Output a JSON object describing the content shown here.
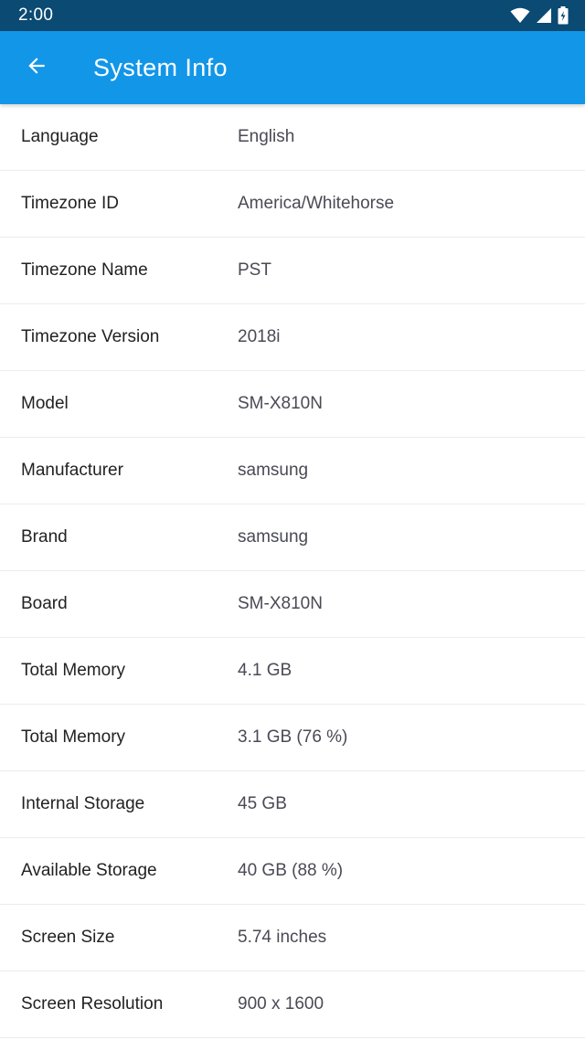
{
  "status_bar": {
    "time": "2:00",
    "icons": [
      "wifi-icon",
      "signal-icon",
      "battery-icon"
    ]
  },
  "app_bar": {
    "title": "System Info",
    "back_icon": "arrow-back-icon",
    "color": "#1296e8"
  },
  "colors": {
    "status_bar": "#0a4a73",
    "app_bar": "#1296e8",
    "label_text": "#222222",
    "value_text": "#4a4a55",
    "divider": "#ececec"
  },
  "rows": [
    {
      "label": "Language",
      "value": "English"
    },
    {
      "label": "Timezone ID",
      "value": "America/Whitehorse"
    },
    {
      "label": "Timezone Name",
      "value": "PST"
    },
    {
      "label": "Timezone Version",
      "value": "2018i"
    },
    {
      "label": "Model",
      "value": "SM-X810N"
    },
    {
      "label": "Manufacturer",
      "value": "samsung"
    },
    {
      "label": "Brand",
      "value": "samsung"
    },
    {
      "label": "Board",
      "value": "SM-X810N"
    },
    {
      "label": "Total Memory",
      "value": "4.1 GB"
    },
    {
      "label": "Total Memory",
      "value": "3.1 GB (76 %)"
    },
    {
      "label": "Internal Storage",
      "value": "45 GB"
    },
    {
      "label": "Available Storage",
      "value": "40 GB (88 %)"
    },
    {
      "label": "Screen Size",
      "value": "5.74 inches"
    },
    {
      "label": "Screen Resolution",
      "value": "900 x 1600"
    }
  ]
}
